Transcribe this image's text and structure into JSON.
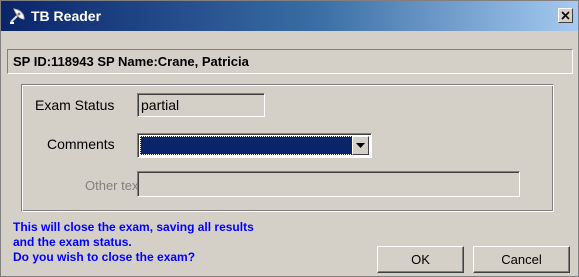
{
  "window": {
    "title": "TB Reader",
    "icon": "satellite-dish-icon",
    "close_icon": "close-icon"
  },
  "sp_info": "SP ID:118943 SP Name:Crane, Patricia",
  "form": {
    "exam_status_label": "Exam Status",
    "exam_status_value": "partial",
    "comments_label": "Comments",
    "comments_value": "",
    "other_text_label": "Other text",
    "other_text_value": ""
  },
  "message": {
    "line1": "This will close the exam, saving all results",
    "line2": "and the exam status.",
    "line3": "Do you wish to close the exam?",
    "color": "#0000ff"
  },
  "buttons": {
    "ok": "OK",
    "cancel": "Cancel"
  },
  "colors": {
    "title_start": "#0a246a",
    "title_end": "#a6caf0",
    "selection": "#0a246a",
    "face": "#d4d0c8"
  }
}
